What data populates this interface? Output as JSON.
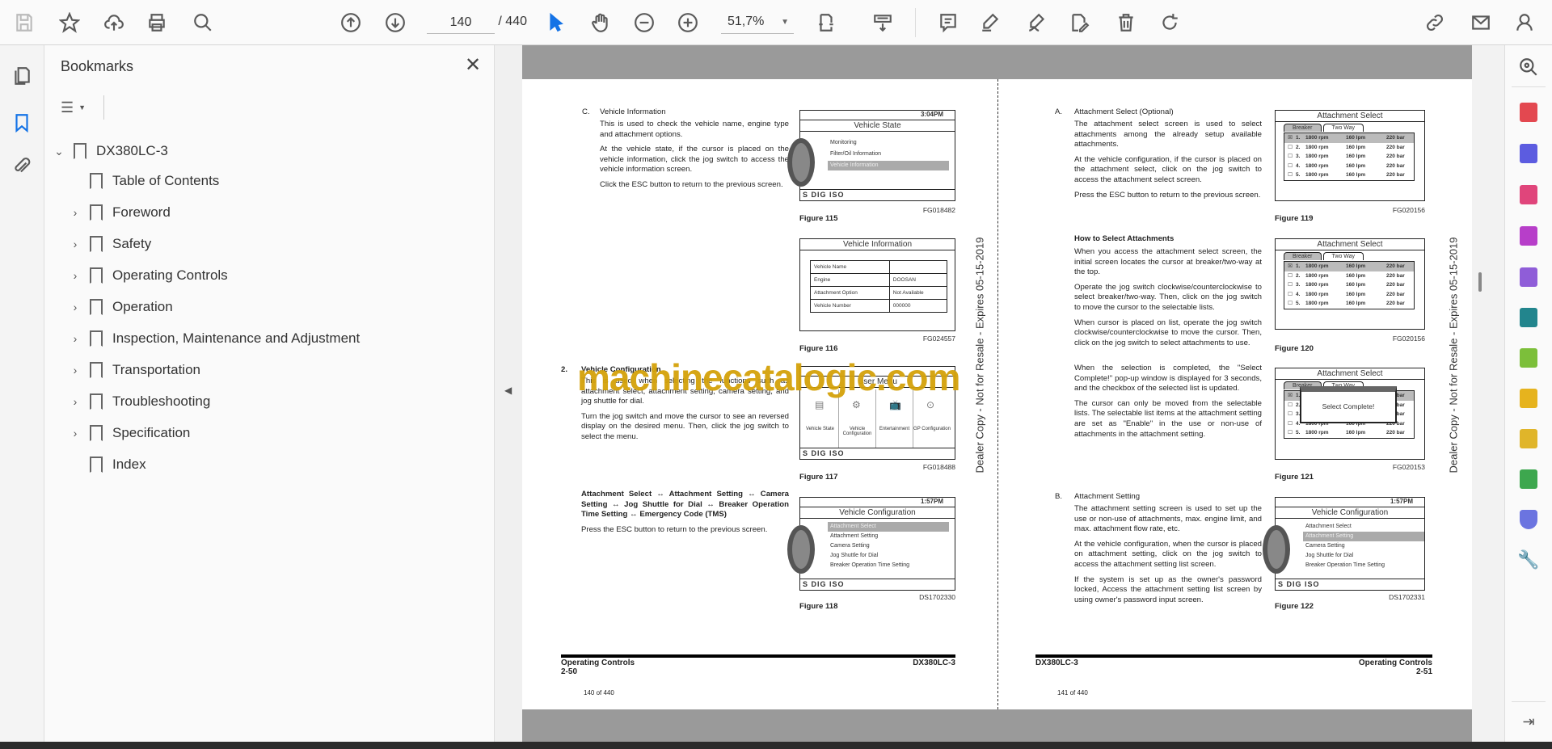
{
  "toolbar": {
    "page_current": "140",
    "page_total": "/ 440",
    "zoom": "51,7%"
  },
  "bookmarks": {
    "title": "Bookmarks",
    "root": "DX380LC-3",
    "items": [
      {
        "label": "Table of Contents",
        "expandable": false
      },
      {
        "label": "Foreword",
        "expandable": true
      },
      {
        "label": "Safety",
        "expandable": true
      },
      {
        "label": "Operating Controls",
        "expandable": true
      },
      {
        "label": "Operation",
        "expandable": true
      },
      {
        "label": "Inspection, Maintenance and Adjustment",
        "expandable": true
      },
      {
        "label": "Transportation",
        "expandable": true
      },
      {
        "label": "Troubleshooting",
        "expandable": true
      },
      {
        "label": "Specification",
        "expandable": true
      },
      {
        "label": "Index",
        "expandable": false
      }
    ]
  },
  "watermark": "machinecatalogic.com",
  "dealer_stamp": "Dealer Copy - Not for Resale - Expires 05-15-2019",
  "left_page": {
    "sec_c_letter": "C.",
    "sec_c_title": "Vehicle Information",
    "sec_c_paras": [
      "This is used to check the vehicle name, engine type and attachment options.",
      "At the vehicle state, if the cursor is placed on the vehicle information, click the jog switch to access the vehicle information screen.",
      "Click the ESC button to return to the previous screen."
    ],
    "sec_2_num": "2.",
    "sec_2_title": "Vehicle Configuration",
    "sec_2_paras": [
      "This is used when selecting the functions such as attachment select, attachment setting, camera setting, and jog shuttle for dial.",
      "Turn the jog switch and move the cursor to see an reversed display on the desired menu. Then, click the jog switch to select the menu."
    ],
    "bold_flow": "Attachment Select ↔ Attachment Setting ↔ Camera Setting ↔ Jog Shuttle for Dial ↔ Breaker Operation Time Setting ↔ Emergency Code (TMS)",
    "esc_para": "Press the ESC button to return to the previous screen.",
    "fig115": {
      "title": "Vehicle State",
      "time": "3:04PM",
      "items": [
        "Monitoring",
        "Filter/Oil Information",
        "Vehicle Information"
      ],
      "status": "S DIG ISO",
      "code": "FG018482",
      "label": "Figure 115"
    },
    "fig116": {
      "title": "Vehicle Information",
      "rows": [
        [
          "Vehicle Name",
          ""
        ],
        [
          "Engine",
          "DOOSAN"
        ],
        [
          "Attachment Option",
          "Not Available"
        ],
        [
          "Vehicle Number",
          "000000"
        ]
      ],
      "code": "FG024557",
      "label": "Figure 116"
    },
    "fig117": {
      "title": "User Menu",
      "cells": [
        "Vehicle State",
        "Vehicle Configuration",
        "Entertainment",
        "GP Configuration"
      ],
      "status": "S DIG ISO",
      "code": "FG018488",
      "label": "Figure 117"
    },
    "fig118": {
      "title": "Vehicle Configuration",
      "time": "1:57PM",
      "items": [
        "Attachment Select",
        "Attachment Setting",
        "Camera Setting",
        "Jog Shuttle for Dial",
        "Breaker Operation Time Setting"
      ],
      "status": "S DIG ISO",
      "code": "DS1702330",
      "label": "Figure 118"
    },
    "footer_section": "Operating Controls",
    "footer_page": "2-50",
    "footer_model": "DX380LC-3",
    "page_of": "140 of 440"
  },
  "right_page": {
    "sec_a_letter": "A.",
    "sec_a_title": "Attachment Select (Optional)",
    "sec_a_paras": [
      "The attachment select screen is used to select attachments among the already setup available attachments.",
      "At the vehicle configuration, if the cursor is placed on the attachment select, click on the jog switch to access the attachment select screen.",
      "Press the ESC button to return to the previous screen."
    ],
    "how_title": "How to Select Attachments",
    "how_paras": [
      "When you access the attachment select screen, the initial screen locates the cursor at breaker/two-way at the top.",
      "Operate the jog switch clockwise/counterclockwise to select breaker/two-way. Then, click on the jog switch to move the cursor to the selectable lists.",
      "When cursor is placed on list, operate the jog switch clockwise/counterclockwise to move the cursor. Then, click on the jog switch to select attachments to use."
    ],
    "sel_paras": [
      "When the selection is completed, the \"Select Complete!\" pop-up window is displayed for 3 seconds, and the checkbox of the selected list is updated.",
      "The cursor can only be moved from the selectable lists. The selectable list items at the attachment setting are set as \"Enable\" in the use or non-use of attachments in the attachment setting."
    ],
    "sec_b_letter": "B.",
    "sec_b_title": "Attachment Setting",
    "sec_b_paras": [
      "The attachment setting screen is used to set up the use or non-use of attachments, max. engine limit, and max. attachment flow rate, etc.",
      "At the vehicle configuration, when the cursor is placed on attachment setting, click on the jog switch to access the attachment setting list screen.",
      "If the system is set up as the owner's password locked, Access the attachment setting list screen by using owner's password input screen."
    ],
    "attach_tabs": [
      "Breaker",
      "Two Way"
    ],
    "attach_rows": [
      [
        "1.",
        "1800 rpm",
        "160 lpm",
        "220 bar"
      ],
      [
        "2.",
        "1800 rpm",
        "160 lpm",
        "220 bar"
      ],
      [
        "3.",
        "1800 rpm",
        "160 lpm",
        "220 bar"
      ],
      [
        "4.",
        "1800 rpm",
        "160 lpm",
        "220 bar"
      ],
      [
        "5.",
        "1800 rpm",
        "160 lpm",
        "220 bar"
      ]
    ],
    "fig119": {
      "title": "Attachment Select",
      "code": "FG020156",
      "label": "Figure 119"
    },
    "fig120": {
      "title": "Attachment Select",
      "code": "FG020156",
      "label": "Figure 120"
    },
    "fig121": {
      "title": "Attachment Select",
      "popup": "Select Complete!",
      "code": "FG020153",
      "label": "Figure 121"
    },
    "fig122": {
      "title": "Vehicle Configuration",
      "time": "1:57PM",
      "items": [
        "Attachment Select",
        "Attachment Setting",
        "Camera Setting",
        "Jog Shuttle for Dial",
        "Breaker Operation Time Setting"
      ],
      "status": "S DIG ISO",
      "code": "DS1702331",
      "label": "Figure 122"
    },
    "footer_model": "DX380LC-3",
    "footer_section": "Operating Controls",
    "footer_page": "2-51",
    "page_of": "141 of 440"
  }
}
